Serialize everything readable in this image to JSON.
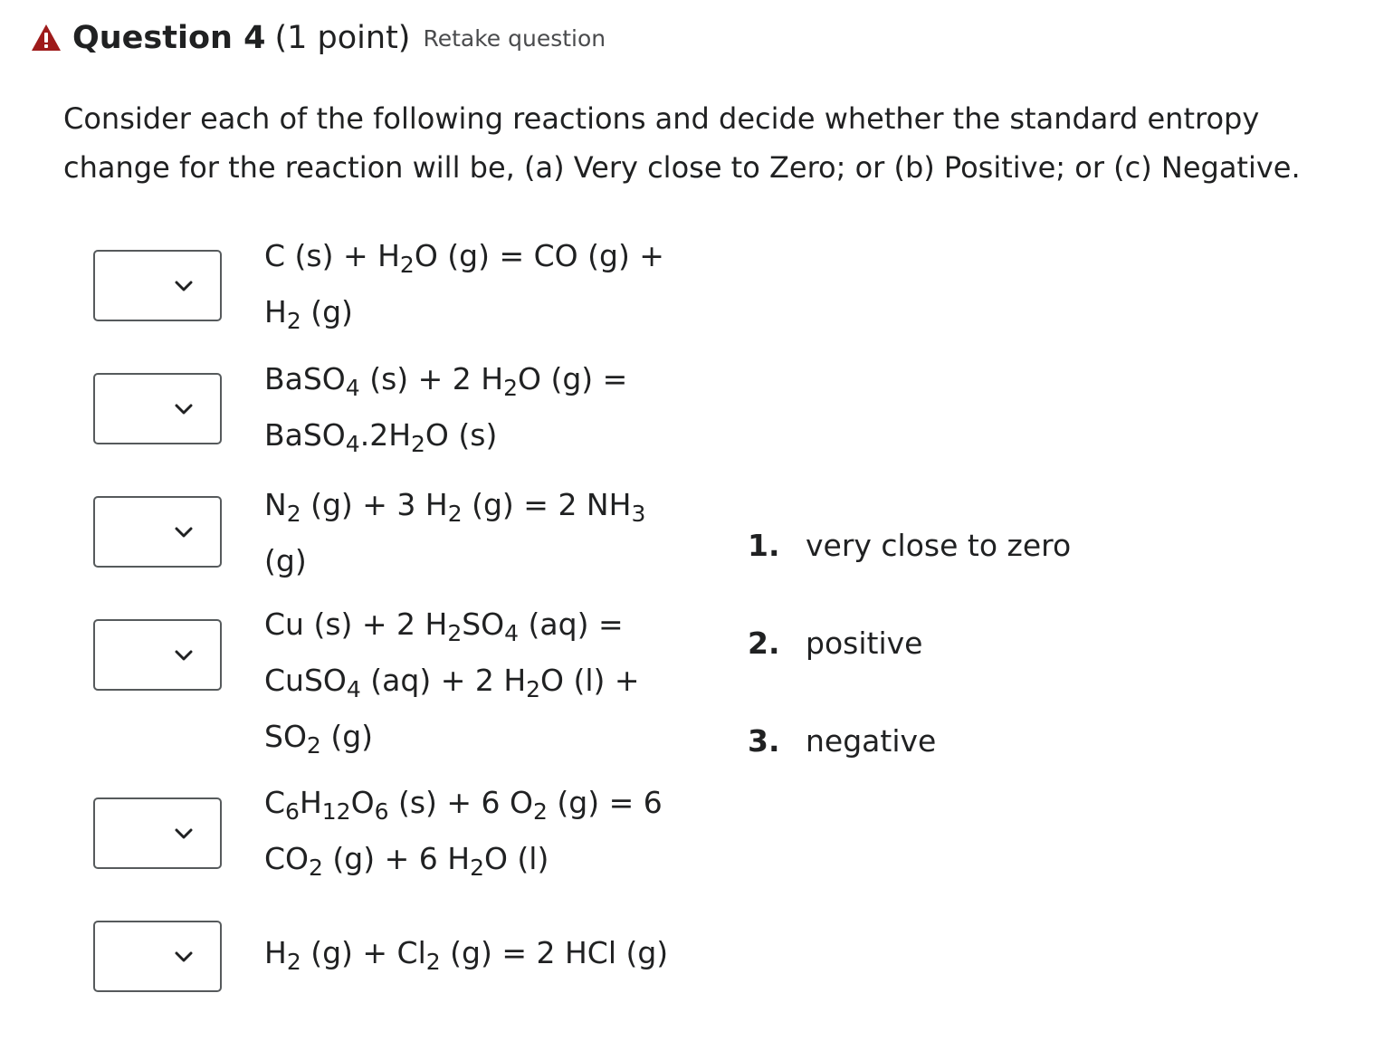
{
  "question": {
    "title": "Question 4",
    "points": "(1 point)",
    "retake_label": "Retake question",
    "prompt": "Consider each of the following reactions and decide whether the standard entropy change for the reaction will be, (a) Very close to Zero; or (b) Positive; or (c) Negative."
  },
  "reactions": [
    {
      "selected": "",
      "lines": [
        [
          [
            "C (s) + H",
            ""
          ],
          [
            "2",
            "sub"
          ],
          [
            "O (g) = CO (g) +",
            ""
          ]
        ],
        [
          [
            "H",
            ""
          ],
          [
            "2",
            "sub"
          ],
          [
            " (g)",
            ""
          ]
        ]
      ]
    },
    {
      "selected": "",
      "lines": [
        [
          [
            "BaSO",
            ""
          ],
          [
            "4",
            "sub"
          ],
          [
            " (s) + 2 H",
            ""
          ],
          [
            "2",
            "sub"
          ],
          [
            "O (g) =",
            ""
          ]
        ],
        [
          [
            "BaSO",
            ""
          ],
          [
            "4",
            "sub"
          ],
          [
            ".2H",
            ""
          ],
          [
            "2",
            "sub"
          ],
          [
            "O (s)",
            ""
          ]
        ]
      ]
    },
    {
      "selected": "",
      "lines": [
        [
          [
            "N",
            ""
          ],
          [
            "2",
            "sub"
          ],
          [
            " (g) + 3 H",
            ""
          ],
          [
            "2",
            "sub"
          ],
          [
            " (g) = 2 NH",
            ""
          ],
          [
            "3",
            "sub"
          ]
        ],
        [
          [
            "(g)",
            ""
          ]
        ]
      ]
    },
    {
      "selected": "",
      "lines": [
        [
          [
            "Cu (s) + 2 H",
            ""
          ],
          [
            "2",
            "sub"
          ],
          [
            "SO",
            ""
          ],
          [
            "4",
            "sub"
          ],
          [
            " (aq) =",
            ""
          ]
        ],
        [
          [
            "CuSO",
            ""
          ],
          [
            "4",
            "sub"
          ],
          [
            " (aq) + 2 H",
            ""
          ],
          [
            "2",
            "sub"
          ],
          [
            "O (l) +",
            ""
          ]
        ],
        [
          [
            "SO",
            ""
          ],
          [
            "2",
            "sub"
          ],
          [
            " (g)",
            ""
          ]
        ]
      ]
    },
    {
      "selected": "",
      "lines": [
        [
          [
            "C",
            ""
          ],
          [
            "6",
            "sub"
          ],
          [
            "H",
            ""
          ],
          [
            "12",
            "sub"
          ],
          [
            "O",
            ""
          ],
          [
            "6",
            "sub"
          ],
          [
            " (s) + 6 O",
            ""
          ],
          [
            "2",
            "sub"
          ],
          [
            " (g) = 6",
            ""
          ]
        ],
        [
          [
            "CO",
            ""
          ],
          [
            "2",
            "sub"
          ],
          [
            " (g) + 6 H",
            ""
          ],
          [
            "2",
            "sub"
          ],
          [
            "O (l)",
            ""
          ]
        ]
      ]
    },
    {
      "selected": "",
      "lines": [
        [
          [
            "H",
            ""
          ],
          [
            "2",
            "sub"
          ],
          [
            " (g) + Cl",
            ""
          ],
          [
            "2",
            "sub"
          ],
          [
            " (g) = 2 HCl (g)",
            ""
          ]
        ]
      ]
    }
  ],
  "options": [
    {
      "number": "1.",
      "label": "very close to zero"
    },
    {
      "number": "2.",
      "label": "positive"
    },
    {
      "number": "3.",
      "label": "negative"
    }
  ],
  "colors": {
    "warning": "#9e1b1b",
    "text": "#202122",
    "select_border": "#565a5c"
  },
  "icons": {
    "warning": "warning-triangle-icon",
    "dropdown": "chevron-down-icon"
  }
}
